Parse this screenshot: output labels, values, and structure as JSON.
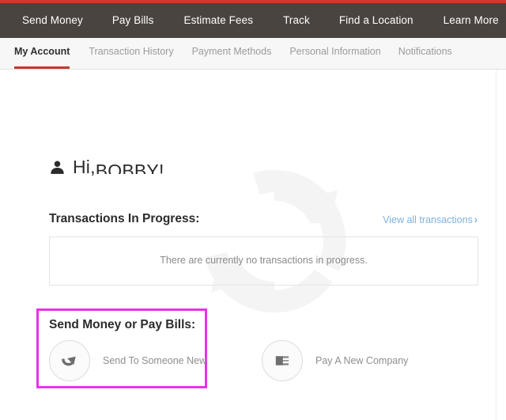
{
  "theme": {
    "accent_strip_color": "#cd3a26",
    "nav_background": "#4a4440",
    "tab_active_underline": "#c0392b",
    "highlight_box_color": "#e832e8",
    "link_color": "#7fb2e0"
  },
  "mainnav": {
    "items": [
      {
        "label": "Send Money"
      },
      {
        "label": "Pay Bills"
      },
      {
        "label": "Estimate Fees"
      },
      {
        "label": "Track"
      },
      {
        "label": "Find a Location"
      },
      {
        "label": "Learn More"
      }
    ]
  },
  "subnav": {
    "tabs": [
      {
        "label": "My Account",
        "active": true
      },
      {
        "label": "Transaction History",
        "active": false
      },
      {
        "label": "Payment Methods",
        "active": false
      },
      {
        "label": "Personal Information",
        "active": false
      },
      {
        "label": "Notifications",
        "active": false
      }
    ]
  },
  "greeting": {
    "icon": "person-icon",
    "salutation": "Hi, ",
    "name": "BOBBY!"
  },
  "transactions": {
    "heading": "Transactions In Progress:",
    "view_all_label": "View all transactions",
    "view_all_chevron": "›",
    "empty_message": "There are currently no transactions in progress."
  },
  "send_or_pay": {
    "heading": "Send Money or Pay Bills:",
    "actions": [
      {
        "icon": "send-arrow-icon",
        "label": "Send To Someone New"
      },
      {
        "icon": "wallet-icon",
        "label": "Pay A New Company"
      }
    ]
  },
  "watermark": {
    "icon": "refresh-circular-arrow-watermark"
  }
}
